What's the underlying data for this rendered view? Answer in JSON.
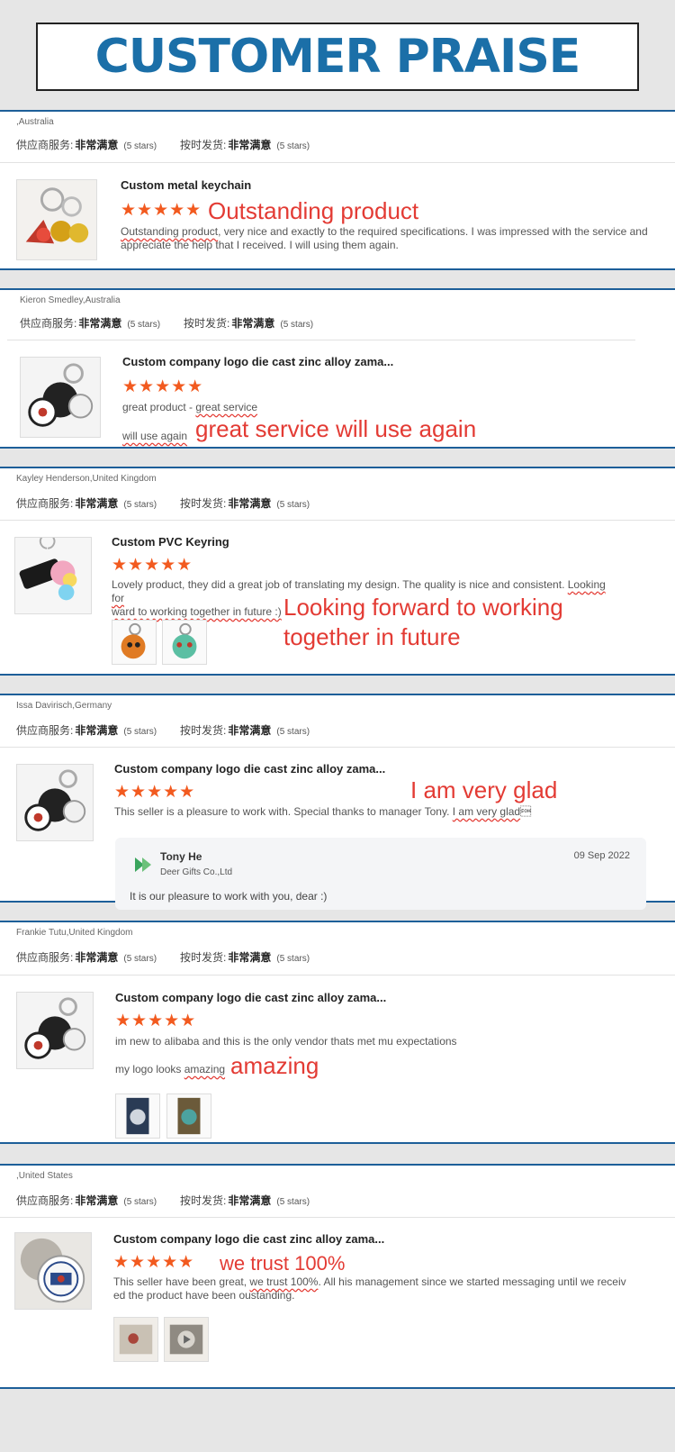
{
  "header": {
    "title": "CUSTOMER PRAISE"
  },
  "common": {
    "supplier_label": "供应商服务:",
    "delivery_label": "按时发货:",
    "rating_value": "非常满意",
    "rating_stars": "(5 stars)",
    "stars": "★★★★★"
  },
  "reviews": [
    {
      "meta": ",Australia",
      "product": "Custom metal keychain",
      "callout": "Outstanding product",
      "text_a": "Outstanding product",
      "text_b": ", very nice and exactly to the required specifications. I was impressed with the service and appreciate the help that I received. I will using them again."
    },
    {
      "meta": "Kieron Smedley,Australia",
      "product": "Custom company logo die cast zinc alloy zama...",
      "line1_a": "great product - ",
      "line1_b": "great service",
      "line2": "will use again",
      "callout": "great service will use again"
    },
    {
      "meta": "Kayley Henderson,United Kingdom",
      "product": "Custom PVC Keyring",
      "text_a": "Lovely product, they did a great job of translating my design. The quality is nice and consistent. ",
      "text_b": "Looking for",
      "text_c": "ward to working together in future :)",
      "callout_line1": "Looking forward to working",
      "callout_line2": "together in future"
    },
    {
      "meta": "Issa Davirisch,Germany",
      "product": "Custom company logo die cast zinc alloy zama...",
      "callout": "I am very glad",
      "text_a": "This seller is a pleasure to work with.  Special thanks to manager Tony.  ",
      "text_b": "I am very glad",
      "text_c": "\u0001",
      "reply": {
        "name": "Tony He",
        "company": "Deer Gifts Co.,Ltd",
        "date": "09 Sep 2022",
        "text": "It is our pleasure to work with you, dear :)"
      }
    },
    {
      "meta": "Frankie Tutu,United Kingdom",
      "product": "Custom company logo die cast zinc alloy zama...",
      "text1": "im new to alibaba and this is the only vendor thats met mu expectations",
      "text2_a": "my logo looks ",
      "text2_b": "amazing",
      "callout": "amazing"
    },
    {
      "meta": ",United States",
      "product": "Custom company logo die cast zinc alloy zama...",
      "callout": "we trust 100%",
      "text_a": "This seller have been great, ",
      "text_b": "we trust 100%",
      "text_c": ". All his management since we started messaging until we receiv",
      "text_d": "ed the product have been oustanding."
    }
  ]
}
